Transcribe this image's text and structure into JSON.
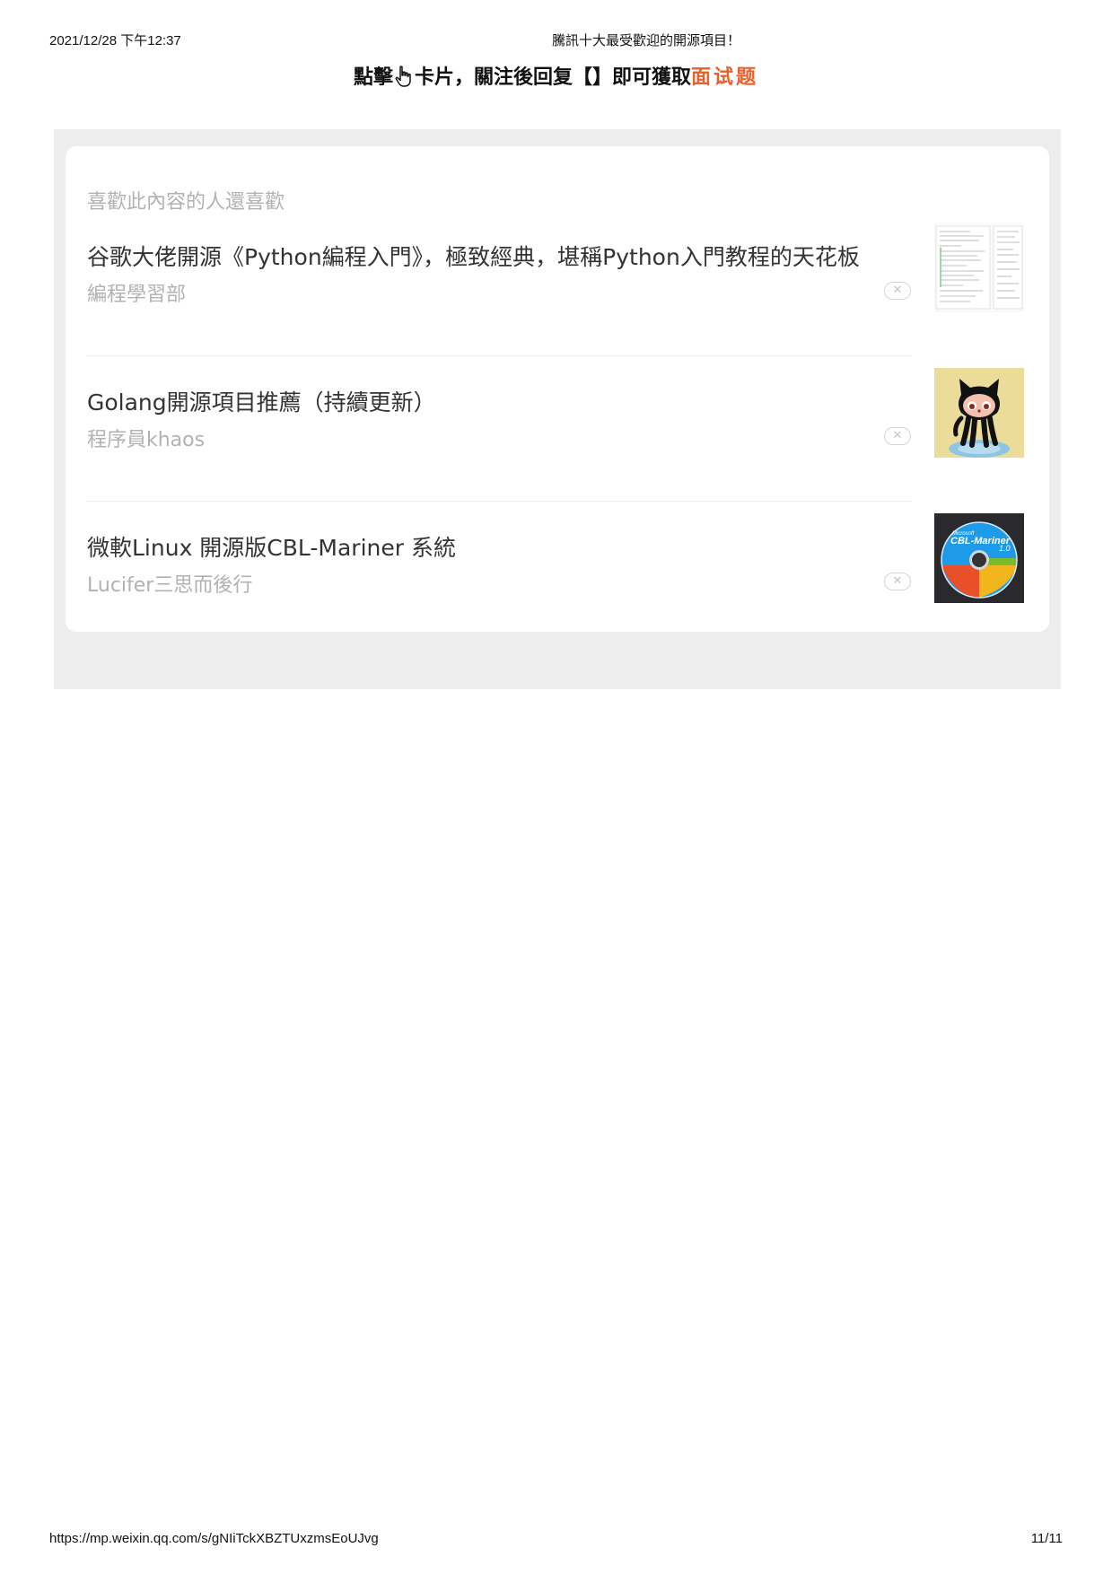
{
  "print_header": {
    "datetime": "2021/12/28 下午12:37",
    "document_title": "騰訊十大最受歡迎的開源項目！"
  },
  "cta": {
    "text_before_icon": "點擊",
    "hand_icon": "pointing-hand-icon",
    "text_after_icon": "卡片，關注後回复【】即可獲取",
    "accent_text": "面试题",
    "accent_color": "#e8612c"
  },
  "recommendations": {
    "heading": "喜歡此內容的人還喜歡",
    "items": [
      {
        "title": "谷歌大佬開源《Python編程入門》，極致經典，堪稱Python入門教程的天花板",
        "source": "編程學習部",
        "thumbnail": "document-screenshot-thumbnail"
      },
      {
        "title": "Golang開源項目推薦（持續更新）",
        "source": "程序員khaos",
        "thumbnail": "github-octocat-thumbnail"
      },
      {
        "title": "微軟Linux 開源版CBL-Mariner 系統",
        "source": "Lucifer三思而後行",
        "thumbnail": "cbl-mariner-disc-thumbnail",
        "thumbnail_brand": "Microsoft",
        "thumbnail_label": "CBL-Mariner",
        "thumbnail_version": "1.0"
      }
    ],
    "dismiss_glyph": "✕"
  },
  "print_footer": {
    "url": "https://mp.weixin.qq.com/s/gNIiTckXBZTUxzmsEoUJvg",
    "page": "11/11"
  }
}
